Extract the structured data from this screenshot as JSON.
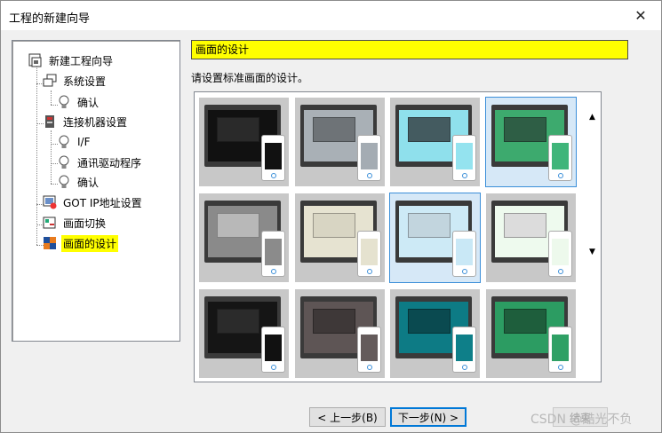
{
  "window": {
    "title": "工程的新建向导",
    "close_icon": "close-icon"
  },
  "tree": {
    "items": [
      {
        "label": "新建工程向导",
        "icon": "wizard-icon"
      },
      {
        "label": "系统设置",
        "icon": "system-icon"
      },
      {
        "label": "确认",
        "icon": "bulb-icon"
      },
      {
        "label": "连接机器设置",
        "icon": "device-icon"
      },
      {
        "label": "I/F",
        "icon": "bulb-icon"
      },
      {
        "label": "通讯驱动程序",
        "icon": "bulb-icon"
      },
      {
        "label": "确认",
        "icon": "bulb-icon"
      },
      {
        "label": "GOT IP地址设置",
        "icon": "ip-icon"
      },
      {
        "label": "画面切换",
        "icon": "screen-switch-icon"
      },
      {
        "label": "画面的设计",
        "icon": "design-icon",
        "selected": true
      }
    ]
  },
  "main": {
    "header": "画面的设计",
    "instruction": "请设置标准画面的设计。",
    "designs": [
      {
        "bg": "#111111",
        "dlg": "#2a2a2a",
        "phone": "#111111"
      },
      {
        "bg": "#a9b0b6",
        "dlg": "#6e7377",
        "phone": "#a4acb3"
      },
      {
        "bg": "#8fe0ec",
        "dlg": "#445b60",
        "phone": "#94e3ef"
      },
      {
        "bg": "#3daa6e",
        "dlg": "#2e5e45",
        "phone": "#3fb57a",
        "selected": true
      },
      {
        "bg": "#8a8a8a",
        "dlg": "#b8b8b8",
        "phone": "#8b8b8b"
      },
      {
        "bg": "#e6e3d1",
        "dlg": "#d8d5c3",
        "phone": "#e5e2cf"
      },
      {
        "bg": "#cdeaf6",
        "dlg": "#c2d5de",
        "phone": "#c9e8f6",
        "selected": true
      },
      {
        "bg": "#eefaee",
        "dlg": "#dcdcdc",
        "phone": "#edf9ec"
      },
      {
        "bg": "#151515",
        "dlg": "#2b2b2b",
        "phone": "#111111"
      },
      {
        "bg": "#5e5555",
        "dlg": "#3e3838",
        "phone": "#645b5b"
      },
      {
        "bg": "#0d7b85",
        "dlg": "#0a4a50",
        "phone": "#0e7f89"
      },
      {
        "bg": "#2c9c62",
        "dlg": "#1e5e3c",
        "phone": "#2fa065"
      }
    ]
  },
  "buttons": {
    "back": "< 上一步(B)",
    "next": "下一步(N) >",
    "finish": "结束"
  },
  "watermark": "CSDN @酷光不负"
}
